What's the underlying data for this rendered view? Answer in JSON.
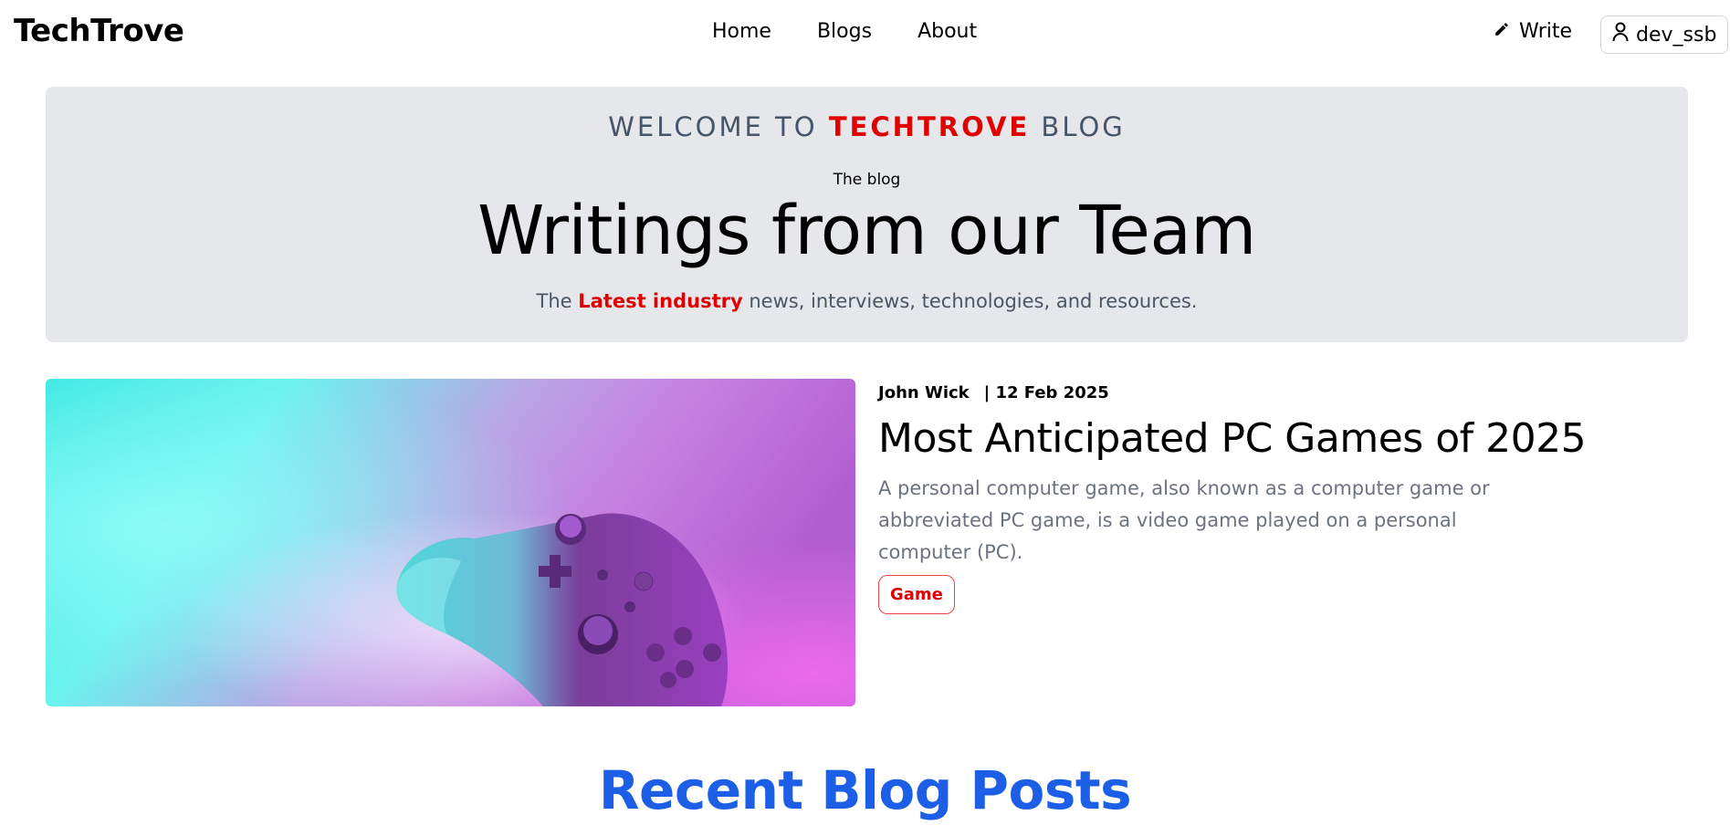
{
  "navbar": {
    "brand": "TechTrove",
    "links": [
      "Home",
      "Blogs",
      "About"
    ],
    "write_label": "Write",
    "user_label": "dev_ssb"
  },
  "hero": {
    "welcome_prefix": "WELCOME TO",
    "welcome_brand": "TECHTROVE",
    "welcome_suffix": "BLOG",
    "subtitle": "The blog",
    "title": "Writings from our Team",
    "desc_prefix": "The",
    "desc_highlight": "Latest industry",
    "desc_suffix": "news, interviews, technologies, and resources."
  },
  "featured": {
    "author": "John Wick",
    "date": "| 12 Feb 2025",
    "title": "Most Anticipated PC Games of 2025",
    "excerpt": "A personal computer game, also known as a computer game or abbreviated PC game, is a video game played on a personal computer (PC).",
    "tag": "Game"
  },
  "recent": {
    "heading": "Recent Blog Posts"
  },
  "colors": {
    "accent_red": "#e00000",
    "heading_blue": "#1d5ee6",
    "hero_bg": "#e5e7eb"
  }
}
